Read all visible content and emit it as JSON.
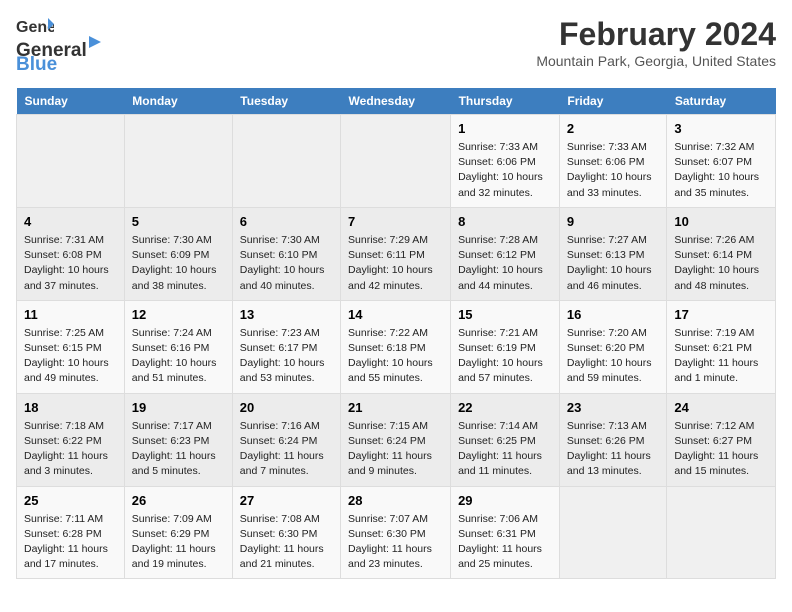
{
  "header": {
    "logo_general": "General",
    "logo_blue": "Blue",
    "month_title": "February 2024",
    "location": "Mountain Park, Georgia, United States"
  },
  "days_of_week": [
    "Sunday",
    "Monday",
    "Tuesday",
    "Wednesday",
    "Thursday",
    "Friday",
    "Saturday"
  ],
  "weeks": [
    [
      {
        "day": "",
        "empty": true
      },
      {
        "day": "",
        "empty": true
      },
      {
        "day": "",
        "empty": true
      },
      {
        "day": "",
        "empty": true
      },
      {
        "day": "1",
        "empty": false,
        "sunrise": "7:33 AM",
        "sunset": "6:06 PM",
        "daylight": "10 hours and 32 minutes."
      },
      {
        "day": "2",
        "empty": false,
        "sunrise": "7:33 AM",
        "sunset": "6:06 PM",
        "daylight": "10 hours and 33 minutes."
      },
      {
        "day": "3",
        "empty": false,
        "sunrise": "7:32 AM",
        "sunset": "6:07 PM",
        "daylight": "10 hours and 35 minutes."
      }
    ],
    [
      {
        "day": "4",
        "empty": false,
        "sunrise": "7:31 AM",
        "sunset": "6:08 PM",
        "daylight": "10 hours and 37 minutes."
      },
      {
        "day": "5",
        "empty": false,
        "sunrise": "7:30 AM",
        "sunset": "6:09 PM",
        "daylight": "10 hours and 38 minutes."
      },
      {
        "day": "6",
        "empty": false,
        "sunrise": "7:30 AM",
        "sunset": "6:10 PM",
        "daylight": "10 hours and 40 minutes."
      },
      {
        "day": "7",
        "empty": false,
        "sunrise": "7:29 AM",
        "sunset": "6:11 PM",
        "daylight": "10 hours and 42 minutes."
      },
      {
        "day": "8",
        "empty": false,
        "sunrise": "7:28 AM",
        "sunset": "6:12 PM",
        "daylight": "10 hours and 44 minutes."
      },
      {
        "day": "9",
        "empty": false,
        "sunrise": "7:27 AM",
        "sunset": "6:13 PM",
        "daylight": "10 hours and 46 minutes."
      },
      {
        "day": "10",
        "empty": false,
        "sunrise": "7:26 AM",
        "sunset": "6:14 PM",
        "daylight": "10 hours and 48 minutes."
      }
    ],
    [
      {
        "day": "11",
        "empty": false,
        "sunrise": "7:25 AM",
        "sunset": "6:15 PM",
        "daylight": "10 hours and 49 minutes."
      },
      {
        "day": "12",
        "empty": false,
        "sunrise": "7:24 AM",
        "sunset": "6:16 PM",
        "daylight": "10 hours and 51 minutes."
      },
      {
        "day": "13",
        "empty": false,
        "sunrise": "7:23 AM",
        "sunset": "6:17 PM",
        "daylight": "10 hours and 53 minutes."
      },
      {
        "day": "14",
        "empty": false,
        "sunrise": "7:22 AM",
        "sunset": "6:18 PM",
        "daylight": "10 hours and 55 minutes."
      },
      {
        "day": "15",
        "empty": false,
        "sunrise": "7:21 AM",
        "sunset": "6:19 PM",
        "daylight": "10 hours and 57 minutes."
      },
      {
        "day": "16",
        "empty": false,
        "sunrise": "7:20 AM",
        "sunset": "6:20 PM",
        "daylight": "10 hours and 59 minutes."
      },
      {
        "day": "17",
        "empty": false,
        "sunrise": "7:19 AM",
        "sunset": "6:21 PM",
        "daylight": "11 hours and 1 minute."
      }
    ],
    [
      {
        "day": "18",
        "empty": false,
        "sunrise": "7:18 AM",
        "sunset": "6:22 PM",
        "daylight": "11 hours and 3 minutes."
      },
      {
        "day": "19",
        "empty": false,
        "sunrise": "7:17 AM",
        "sunset": "6:23 PM",
        "daylight": "11 hours and 5 minutes."
      },
      {
        "day": "20",
        "empty": false,
        "sunrise": "7:16 AM",
        "sunset": "6:24 PM",
        "daylight": "11 hours and 7 minutes."
      },
      {
        "day": "21",
        "empty": false,
        "sunrise": "7:15 AM",
        "sunset": "6:24 PM",
        "daylight": "11 hours and 9 minutes."
      },
      {
        "day": "22",
        "empty": false,
        "sunrise": "7:14 AM",
        "sunset": "6:25 PM",
        "daylight": "11 hours and 11 minutes."
      },
      {
        "day": "23",
        "empty": false,
        "sunrise": "7:13 AM",
        "sunset": "6:26 PM",
        "daylight": "11 hours and 13 minutes."
      },
      {
        "day": "24",
        "empty": false,
        "sunrise": "7:12 AM",
        "sunset": "6:27 PM",
        "daylight": "11 hours and 15 minutes."
      }
    ],
    [
      {
        "day": "25",
        "empty": false,
        "sunrise": "7:11 AM",
        "sunset": "6:28 PM",
        "daylight": "11 hours and 17 minutes."
      },
      {
        "day": "26",
        "empty": false,
        "sunrise": "7:09 AM",
        "sunset": "6:29 PM",
        "daylight": "11 hours and 19 minutes."
      },
      {
        "day": "27",
        "empty": false,
        "sunrise": "7:08 AM",
        "sunset": "6:30 PM",
        "daylight": "11 hours and 21 minutes."
      },
      {
        "day": "28",
        "empty": false,
        "sunrise": "7:07 AM",
        "sunset": "6:30 PM",
        "daylight": "11 hours and 23 minutes."
      },
      {
        "day": "29",
        "empty": false,
        "sunrise": "7:06 AM",
        "sunset": "6:31 PM",
        "daylight": "11 hours and 25 minutes."
      },
      {
        "day": "",
        "empty": true
      },
      {
        "day": "",
        "empty": true
      }
    ]
  ]
}
